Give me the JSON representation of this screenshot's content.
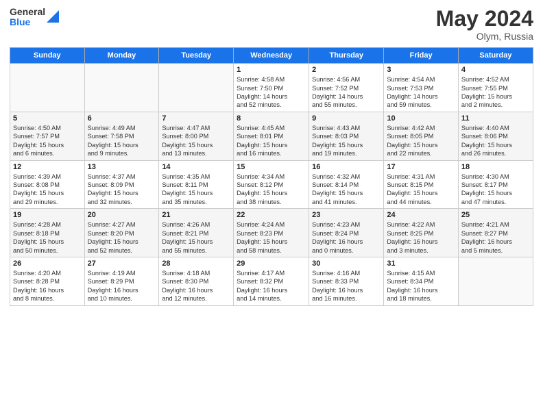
{
  "header": {
    "logo_general": "General",
    "logo_blue": "Blue",
    "title": "May 2024",
    "location": "Olym, Russia"
  },
  "weekdays": [
    "Sunday",
    "Monday",
    "Tuesday",
    "Wednesday",
    "Thursday",
    "Friday",
    "Saturday"
  ],
  "weeks": [
    [
      {
        "day": "",
        "info": ""
      },
      {
        "day": "",
        "info": ""
      },
      {
        "day": "",
        "info": ""
      },
      {
        "day": "1",
        "info": "Sunrise: 4:58 AM\nSunset: 7:50 PM\nDaylight: 14 hours\nand 52 minutes."
      },
      {
        "day": "2",
        "info": "Sunrise: 4:56 AM\nSunset: 7:52 PM\nDaylight: 14 hours\nand 55 minutes."
      },
      {
        "day": "3",
        "info": "Sunrise: 4:54 AM\nSunset: 7:53 PM\nDaylight: 14 hours\nand 59 minutes."
      },
      {
        "day": "4",
        "info": "Sunrise: 4:52 AM\nSunset: 7:55 PM\nDaylight: 15 hours\nand 2 minutes."
      }
    ],
    [
      {
        "day": "5",
        "info": "Sunrise: 4:50 AM\nSunset: 7:57 PM\nDaylight: 15 hours\nand 6 minutes."
      },
      {
        "day": "6",
        "info": "Sunrise: 4:49 AM\nSunset: 7:58 PM\nDaylight: 15 hours\nand 9 minutes."
      },
      {
        "day": "7",
        "info": "Sunrise: 4:47 AM\nSunset: 8:00 PM\nDaylight: 15 hours\nand 13 minutes."
      },
      {
        "day": "8",
        "info": "Sunrise: 4:45 AM\nSunset: 8:01 PM\nDaylight: 15 hours\nand 16 minutes."
      },
      {
        "day": "9",
        "info": "Sunrise: 4:43 AM\nSunset: 8:03 PM\nDaylight: 15 hours\nand 19 minutes."
      },
      {
        "day": "10",
        "info": "Sunrise: 4:42 AM\nSunset: 8:05 PM\nDaylight: 15 hours\nand 22 minutes."
      },
      {
        "day": "11",
        "info": "Sunrise: 4:40 AM\nSunset: 8:06 PM\nDaylight: 15 hours\nand 26 minutes."
      }
    ],
    [
      {
        "day": "12",
        "info": "Sunrise: 4:39 AM\nSunset: 8:08 PM\nDaylight: 15 hours\nand 29 minutes."
      },
      {
        "day": "13",
        "info": "Sunrise: 4:37 AM\nSunset: 8:09 PM\nDaylight: 15 hours\nand 32 minutes."
      },
      {
        "day": "14",
        "info": "Sunrise: 4:35 AM\nSunset: 8:11 PM\nDaylight: 15 hours\nand 35 minutes."
      },
      {
        "day": "15",
        "info": "Sunrise: 4:34 AM\nSunset: 8:12 PM\nDaylight: 15 hours\nand 38 minutes."
      },
      {
        "day": "16",
        "info": "Sunrise: 4:32 AM\nSunset: 8:14 PM\nDaylight: 15 hours\nand 41 minutes."
      },
      {
        "day": "17",
        "info": "Sunrise: 4:31 AM\nSunset: 8:15 PM\nDaylight: 15 hours\nand 44 minutes."
      },
      {
        "day": "18",
        "info": "Sunrise: 4:30 AM\nSunset: 8:17 PM\nDaylight: 15 hours\nand 47 minutes."
      }
    ],
    [
      {
        "day": "19",
        "info": "Sunrise: 4:28 AM\nSunset: 8:18 PM\nDaylight: 15 hours\nand 50 minutes."
      },
      {
        "day": "20",
        "info": "Sunrise: 4:27 AM\nSunset: 8:20 PM\nDaylight: 15 hours\nand 52 minutes."
      },
      {
        "day": "21",
        "info": "Sunrise: 4:26 AM\nSunset: 8:21 PM\nDaylight: 15 hours\nand 55 minutes."
      },
      {
        "day": "22",
        "info": "Sunrise: 4:24 AM\nSunset: 8:23 PM\nDaylight: 15 hours\nand 58 minutes."
      },
      {
        "day": "23",
        "info": "Sunrise: 4:23 AM\nSunset: 8:24 PM\nDaylight: 16 hours\nand 0 minutes."
      },
      {
        "day": "24",
        "info": "Sunrise: 4:22 AM\nSunset: 8:25 PM\nDaylight: 16 hours\nand 3 minutes."
      },
      {
        "day": "25",
        "info": "Sunrise: 4:21 AM\nSunset: 8:27 PM\nDaylight: 16 hours\nand 5 minutes."
      }
    ],
    [
      {
        "day": "26",
        "info": "Sunrise: 4:20 AM\nSunset: 8:28 PM\nDaylight: 16 hours\nand 8 minutes."
      },
      {
        "day": "27",
        "info": "Sunrise: 4:19 AM\nSunset: 8:29 PM\nDaylight: 16 hours\nand 10 minutes."
      },
      {
        "day": "28",
        "info": "Sunrise: 4:18 AM\nSunset: 8:30 PM\nDaylight: 16 hours\nand 12 minutes."
      },
      {
        "day": "29",
        "info": "Sunrise: 4:17 AM\nSunset: 8:32 PM\nDaylight: 16 hours\nand 14 minutes."
      },
      {
        "day": "30",
        "info": "Sunrise: 4:16 AM\nSunset: 8:33 PM\nDaylight: 16 hours\nand 16 minutes."
      },
      {
        "day": "31",
        "info": "Sunrise: 4:15 AM\nSunset: 8:34 PM\nDaylight: 16 hours\nand 18 minutes."
      },
      {
        "day": "",
        "info": ""
      }
    ]
  ]
}
